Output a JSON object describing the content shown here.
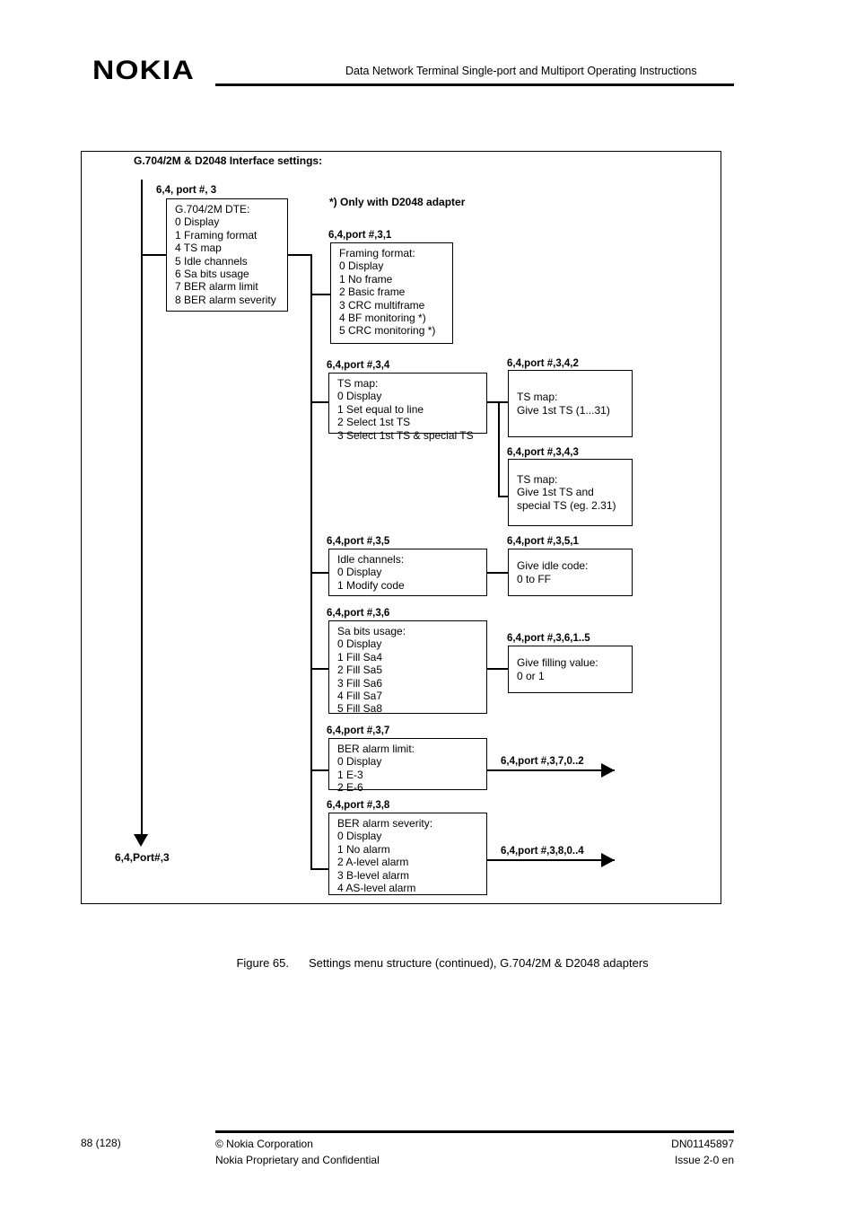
{
  "header": {
    "logo": "NOKIA",
    "title": "Data Network Terminal Single-port and Multiport Operating Instructions"
  },
  "figure": {
    "heading": "G.704/2M & D2048 Interface settings:",
    "footnote": "*) Only with D2048 adapter",
    "trunk_label": "6,4,Port#,3",
    "nodes": {
      "root": {
        "label": "6,4, port #, 3",
        "body": "G.704/2M DTE:\n0 Display\n1 Framing format\n4 TS map\n5 Idle channels\n6 Sa bits usage\n7 BER alarm limit\n8 BER alarm severity"
      },
      "framing": {
        "label": "6,4,port #,3,1",
        "body": "Framing format:\n0 Display\n1 No frame\n2 Basic frame\n3 CRC multiframe\n4 BF monitoring *)\n5 CRC monitoring *)"
      },
      "tsmap": {
        "label": "6,4,port #,3,4",
        "body": "TS map:\n0 Display\n1 Set equal to line\n2 Select 1st TS\n3 Select 1st TS & special TS"
      },
      "tsmap2": {
        "label": "6,4,port #,3,4,2",
        "body": "TS map:\nGive 1st TS (1...31)"
      },
      "tsmap3": {
        "label": "6,4,port #,3,4,3",
        "body": "TS map:\nGive 1st TS and\nspecial TS (eg. 2.31)"
      },
      "idle": {
        "label": "6,4,port #,3,5",
        "body": "Idle channels:\n0 Display\n1 Modify code"
      },
      "idlecode": {
        "label": "6,4,port #,3,5,1",
        "body": "Give idle code:\n0 to FF"
      },
      "sabits": {
        "label": "6,4,port #,3,6",
        "body": "Sa bits usage:\n0 Display\n1 Fill Sa4\n2 Fill Sa5\n3 Fill Sa6\n4 Fill Sa7\n5 Fill Sa8"
      },
      "filling": {
        "label": "6,4,port #,3,6,1..5",
        "body": "Give filling value:\n0 or 1"
      },
      "berlimit": {
        "label": "6,4,port #,3,7",
        "body": "BER alarm limit:\n0 Display\n1 E-3\n2 E-6"
      },
      "berlimit_out": {
        "label": "6,4,port #,3,7,0..2"
      },
      "berseverity": {
        "label": "6,4,port #,3,8",
        "body": "BER alarm severity:\n0 Display\n1 No alarm\n2 A-level alarm\n3 B-level alarm\n4 AS-level alarm"
      },
      "berseverity_out": {
        "label": "6,4,port #,3,8,0..4"
      }
    }
  },
  "caption": {
    "number": "Figure 65.",
    "text": "Settings menu structure (continued), G.704/2M & D2048 adapters"
  },
  "footer": {
    "page": "88 (128)",
    "copyright": "© Nokia Corporation",
    "confidential": "Nokia Proprietary and Confidential",
    "doc_id": "DN01145897",
    "issue": "Issue 2-0 en"
  }
}
